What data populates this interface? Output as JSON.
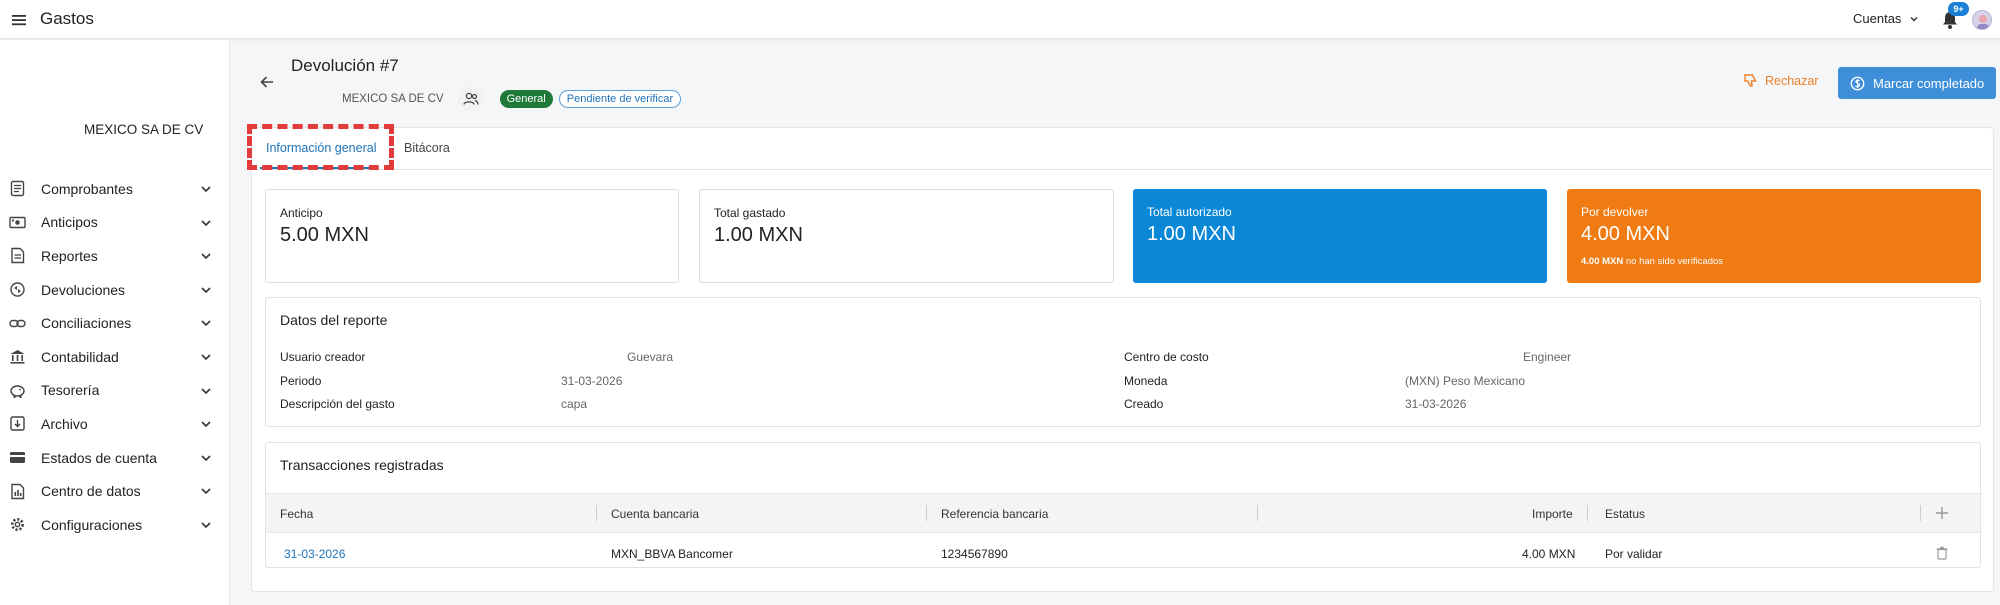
{
  "app": {
    "title": "Gastos"
  },
  "topbar": {
    "accounts_label": "Cuentas",
    "notifications_badge": "9+"
  },
  "sidebar": {
    "company": "MEXICO SA DE CV",
    "items": [
      {
        "label": "Comprobantes",
        "icon": "document-list-icon"
      },
      {
        "label": "Anticipos",
        "icon": "cash-icon"
      },
      {
        "label": "Reportes",
        "icon": "report-icon"
      },
      {
        "label": "Devoluciones",
        "icon": "return-cycle-icon"
      },
      {
        "label": "Conciliaciones",
        "icon": "link-icon"
      },
      {
        "label": "Contabilidad",
        "icon": "bank-icon"
      },
      {
        "label": "Tesorería",
        "icon": "piggy-bank-icon"
      },
      {
        "label": "Archivo",
        "icon": "archive-icon"
      },
      {
        "label": "Estados de cuenta",
        "icon": "credit-card-icon"
      },
      {
        "label": "Centro de datos",
        "icon": "data-center-icon"
      },
      {
        "label": "Configuraciones",
        "icon": "gear-icon"
      }
    ]
  },
  "header": {
    "title": "Devolución #7",
    "company": "MEXICO SA DE CV",
    "badge_general": "General",
    "badge_status": "Pendiente de verificar",
    "reject_label": "Rechazar",
    "complete_label": "Marcar completado"
  },
  "tabs": [
    {
      "label": "Información general",
      "active": true
    },
    {
      "label": "Bitácora",
      "active": false
    }
  ],
  "summary": {
    "anticipo": {
      "label": "Anticipo",
      "value": "5.00 MXN"
    },
    "gastado": {
      "label": "Total gastado",
      "value": "1.00 MXN"
    },
    "autorizado": {
      "label": "Total autorizado",
      "value": "1.00 MXN",
      "color": "#0a87d6"
    },
    "devolver": {
      "label": "Por devolver",
      "value": "4.00 MXN",
      "note_bold": "4.00 MXN",
      "note_rest": " no han sido verificados",
      "color": "#ef7b12"
    }
  },
  "report": {
    "title": "Datos del reporte",
    "usuario_label": "Usuario creador",
    "usuario_value": "Guevara",
    "periodo_label": "Periodo",
    "periodo_value": "31-03-2026",
    "descripcion_label": "Descripción del gasto",
    "descripcion_value": "capa",
    "centro_label": "Centro de costo",
    "centro_value": "Engineer",
    "moneda_label": "Moneda",
    "moneda_value": "(MXN) Peso Mexicano",
    "creado_label": "Creado",
    "creado_value": "31-03-2026"
  },
  "transactions": {
    "title": "Transacciones registradas",
    "columns": [
      "Fecha",
      "Cuenta bancaria",
      "Referencia bancaria",
      "Importe",
      "Estatus"
    ],
    "rows": [
      {
        "fecha": "31-03-2026",
        "cuenta": "MXN_BBVA Bancomer",
        "referencia": "1234567890",
        "importe": "4.00 MXN",
        "estatus": "Por validar"
      }
    ]
  }
}
